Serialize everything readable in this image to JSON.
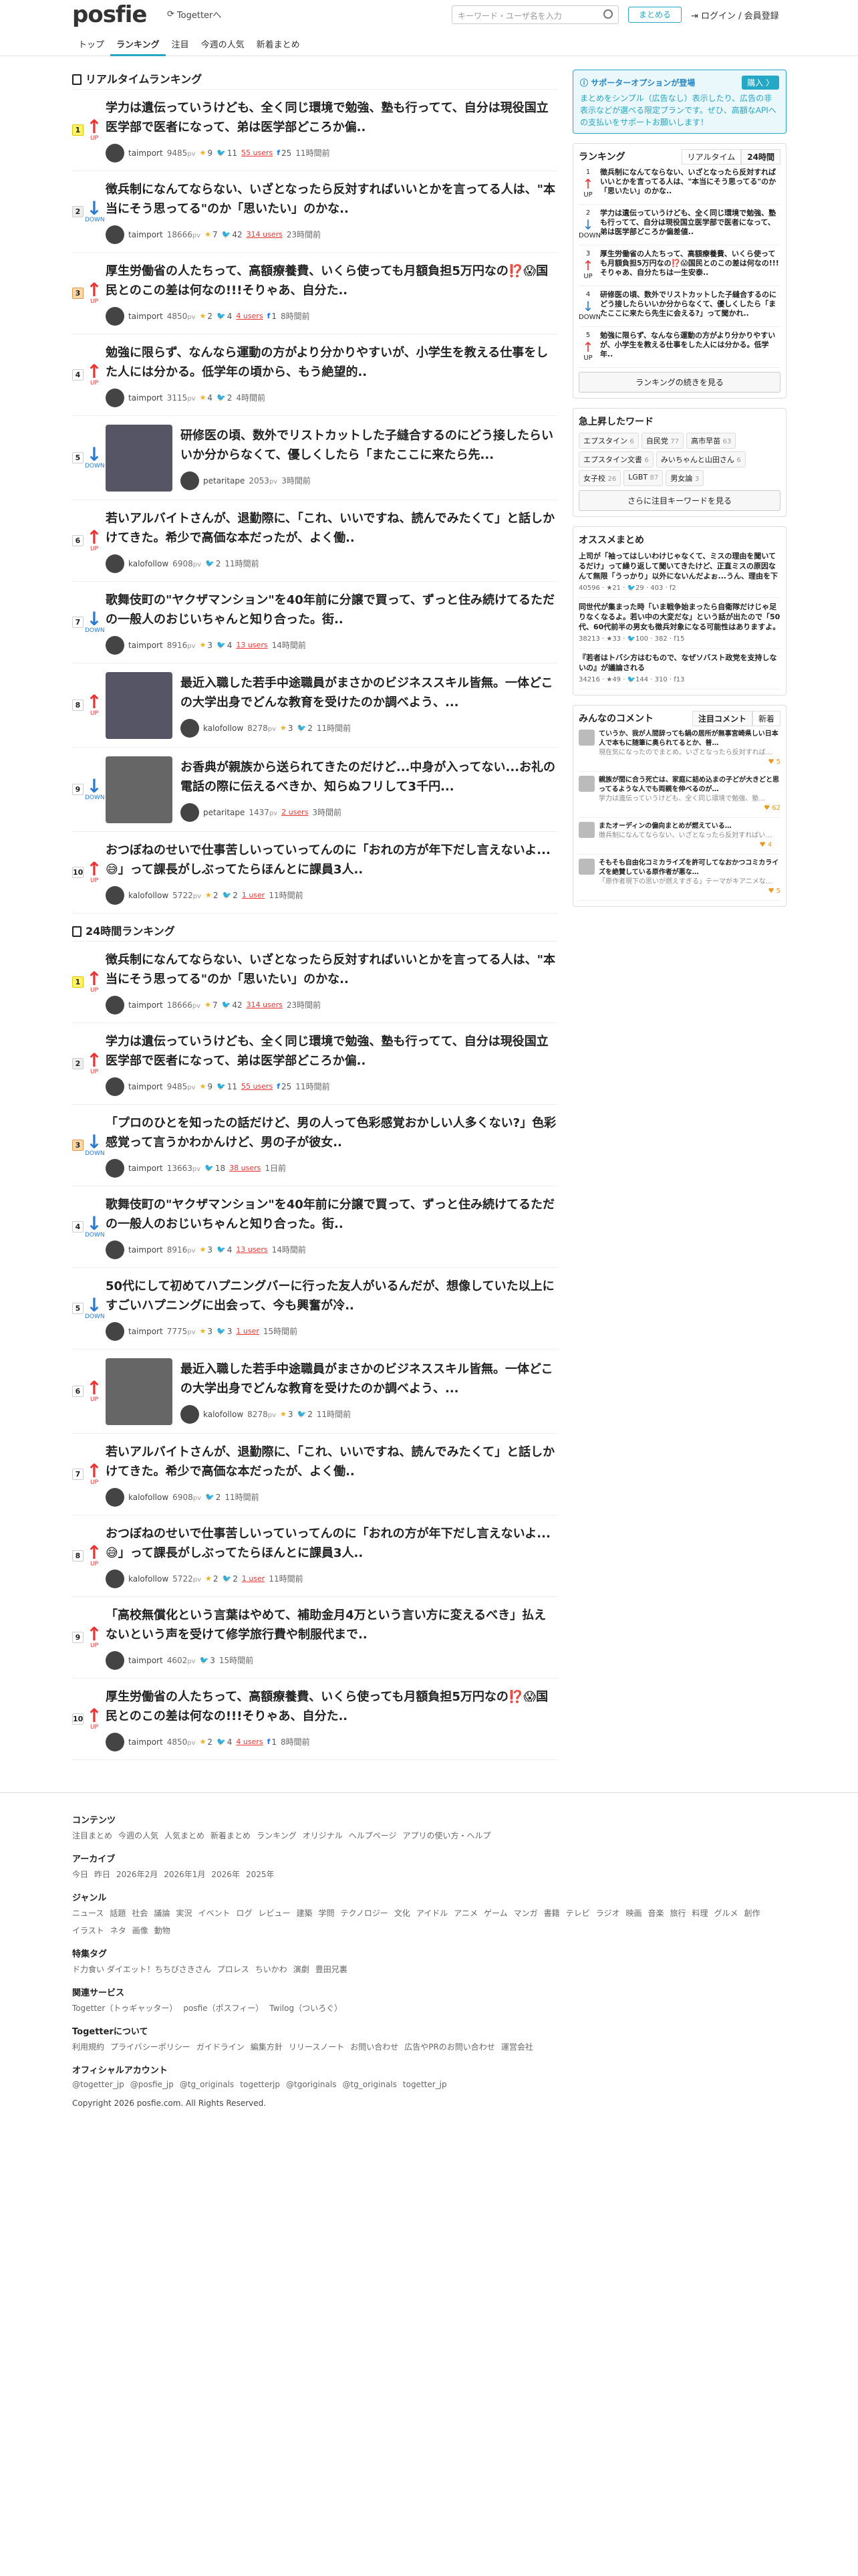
{
  "header": {
    "logo": "posfie",
    "togetter_link": "Togetterへ",
    "search_placeholder": "キーワード・ユーザ名を入力",
    "follow_btn": "まとめる",
    "login": "ログイン / 会員登録"
  },
  "nav": [
    "トップ",
    "ランキング",
    "注目",
    "今週の人気",
    "新着まとめ"
  ],
  "realtime": {
    "title": "リアルタイムランキング",
    "items": [
      {
        "rank": "1",
        "dir": "up",
        "dirlabel": "UP",
        "title": "学力は遺伝っていうけども、全く同じ環境で勉強、塾も行ってて、自分は現役国立医学部で医者になって、弟は医学部どころか偏..",
        "user": "taimport",
        "pv": "9485",
        "star": "9",
        "rt": "11",
        "users": "55 users",
        "fb": "25",
        "time": "11時間前",
        "thumb": false
      },
      {
        "rank": "2",
        "dir": "down",
        "dirlabel": "DOWN",
        "title": "徴兵制になんてならない、いざとなったら反対すればいいとかを言ってる人は、\"本当にそう思ってる\"のか「思いたい」のかな..",
        "user": "taimport",
        "pv": "18666",
        "star": "7",
        "rt": "42",
        "users": "314 users",
        "fb": "",
        "time": "23時間前",
        "thumb": false
      },
      {
        "rank": "3",
        "dir": "up",
        "dirlabel": "UP",
        "title": "厚生労働省の人たちって、高額療養費、いくら使っても月額負担5万円なの⁉️😱国民とのこの差は何なの!!!そりゃあ、自分た..",
        "user": "taimport",
        "pv": "4850",
        "star": "2",
        "rt": "4",
        "users": "4 users",
        "fb": "1",
        "time": "8時間前",
        "thumb": false
      },
      {
        "rank": "4",
        "dir": "up",
        "dirlabel": "UP",
        "title": "勉強に限らず、なんなら運動の方がより分かりやすいが、小学生を教える仕事をした人には分かる。低学年の頃から、もう絶望的..",
        "user": "taimport",
        "pv": "3115",
        "star": "4",
        "rt": "2",
        "users": "",
        "fb": "",
        "time": "4時間前",
        "thumb": false
      },
      {
        "rank": "5",
        "dir": "down",
        "dirlabel": "DOWN",
        "title": "研修医の頃、数外でリストカットした子縫合するのにどう接したらいいか分からなくて、優しくしたら「またここに来たら先...",
        "user": "petaritape",
        "pv": "2053",
        "star": "",
        "rt": "",
        "users": "",
        "fb": "",
        "time": "3時間前",
        "thumb": true
      },
      {
        "rank": "6",
        "dir": "up",
        "dirlabel": "UP",
        "title": "若いアルバイトさんが、退勤際に、「これ、いいですね、読んでみたくて」と話しかけてきた。希少で高価な本だったが、よく働..",
        "user": "kalofollow",
        "pv": "6908",
        "star": "",
        "rt": "2",
        "users": "",
        "fb": "",
        "time": "11時間前",
        "thumb": false
      },
      {
        "rank": "7",
        "dir": "down",
        "dirlabel": "DOWN",
        "title": "歌舞伎町の\"ヤクザマンション\"を40年前に分譲で買って、ずっと住み続けてるただの一般人のおじいちゃんと知り合った。街..",
        "user": "taimport",
        "pv": "8916",
        "star": "3",
        "rt": "4",
        "users": "13 users",
        "fb": "",
        "time": "14時間前",
        "thumb": false
      },
      {
        "rank": "8",
        "dir": "up",
        "dirlabel": "UP",
        "title": "最近入職した若手中途職員がまさかのビジネススキル皆無。一体どこの大学出身でどんな教育を受けたのか調べよう、...",
        "user": "kalofollow",
        "pv": "8278",
        "star": "3",
        "rt": "2",
        "users": "",
        "fb": "",
        "time": "11時間前",
        "thumb": true
      },
      {
        "rank": "9",
        "dir": "down",
        "dirlabel": "DOWN",
        "title": "お香典が親族から送られてきたのだけど...中身が入ってない...お礼の電話の際に伝えるべきか、知らぬフリして3千円...",
        "user": "petaritape",
        "pv": "1437",
        "star": "",
        "rt": "",
        "users": "2 users",
        "fb": "",
        "time": "3時間前",
        "thumb": true
      },
      {
        "rank": "10",
        "dir": "up",
        "dirlabel": "UP",
        "title": "おつぼねのせいで仕事苦しいっていってんのに「おれの方が年下だし言えないよ...😅」って課長がしぶってたらほんとに課員3人..",
        "user": "kalofollow",
        "pv": "5722",
        "star": "2",
        "rt": "2",
        "users": "1 user",
        "fb": "",
        "time": "11時間前",
        "thumb": false
      }
    ]
  },
  "daily": {
    "title": "24時間ランキング",
    "items": [
      {
        "rank": "1",
        "dir": "up",
        "dirlabel": "UP",
        "title": "徴兵制になんてならない、いざとなったら反対すればいいとかを言ってる人は、\"本当にそう思ってる\"のか「思いたい」のかな..",
        "user": "taimport",
        "pv": "18666",
        "star": "7",
        "rt": "42",
        "users": "314 users",
        "fb": "",
        "time": "23時間前",
        "thumb": false
      },
      {
        "rank": "2",
        "dir": "up",
        "dirlabel": "UP",
        "title": "学力は遺伝っていうけども、全く同じ環境で勉強、塾も行ってて、自分は現役国立医学部で医者になって、弟は医学部どころか偏..",
        "user": "taimport",
        "pv": "9485",
        "star": "9",
        "rt": "11",
        "users": "55 users",
        "fb": "25",
        "time": "11時間前",
        "thumb": false
      },
      {
        "rank": "3",
        "dir": "down",
        "dirlabel": "DOWN",
        "title": "「プロのひとを知ったの話だけど、男の人って色彩感覚おかしい人多くない?」色彩感覚って言うかわかんけど、男の子が彼女..",
        "user": "taimport",
        "pv": "13663",
        "star": "",
        "rt": "18",
        "users": "38 users",
        "fb": "",
        "time": "1日前",
        "thumb": false
      },
      {
        "rank": "4",
        "dir": "down",
        "dirlabel": "DOWN",
        "title": "歌舞伎町の\"ヤクザマンション\"を40年前に分譲で買って、ずっと住み続けてるただの一般人のおじいちゃんと知り合った。街..",
        "user": "taimport",
        "pv": "8916",
        "star": "3",
        "rt": "4",
        "users": "13 users",
        "fb": "",
        "time": "14時間前",
        "thumb": false
      },
      {
        "rank": "5",
        "dir": "down",
        "dirlabel": "DOWN",
        "title": "50代にして初めてハプニングバーに行った友人がいるんだが、想像していた以上にすごいハプニングに出会って、今も興奮が冷..",
        "user": "taimport",
        "pv": "7775",
        "star": "3",
        "rt": "3",
        "users": "1 user",
        "fb": "",
        "time": "15時間前",
        "thumb": false
      },
      {
        "rank": "6",
        "dir": "up",
        "dirlabel": "UP",
        "title": "最近入職した若手中途職員がまさかのビジネススキル皆無。一体どこの大学出身でどんな教育を受けたのか調べよう、...",
        "user": "kalofollow",
        "pv": "8278",
        "star": "3",
        "rt": "2",
        "users": "",
        "fb": "",
        "time": "11時間前",
        "thumb": true
      },
      {
        "rank": "7",
        "dir": "up",
        "dirlabel": "UP",
        "title": "若いアルバイトさんが、退勤際に、「これ、いいですね、読んでみたくて」と話しかけてきた。希少で高価な本だったが、よく働..",
        "user": "kalofollow",
        "pv": "6908",
        "star": "",
        "rt": "2",
        "users": "",
        "fb": "",
        "time": "11時間前",
        "thumb": false
      },
      {
        "rank": "8",
        "dir": "up",
        "dirlabel": "UP",
        "title": "おつぼねのせいで仕事苦しいっていってんのに「おれの方が年下だし言えないよ...😅」って課長がしぶってたらほんとに課員3人..",
        "user": "kalofollow",
        "pv": "5722",
        "star": "2",
        "rt": "2",
        "users": "1 user",
        "fb": "",
        "time": "11時間前",
        "thumb": false
      },
      {
        "rank": "9",
        "dir": "up",
        "dirlabel": "UP",
        "title": "「高校無償化という言葉はやめて、補助金月4万という言い方に変えるべき」払えないという声を受けて修学旅行費や制服代まで..",
        "user": "taimport",
        "pv": "4602",
        "star": "",
        "rt": "3",
        "users": "",
        "fb": "",
        "time": "15時間前",
        "thumb": false
      },
      {
        "rank": "10",
        "dir": "up",
        "dirlabel": "UP",
        "title": "厚生労働省の人たちって、高額療養費、いくら使っても月額負担5万円なの⁉️😱国民とのこの差は何なの!!!そりゃあ、自分た..",
        "user": "taimport",
        "pv": "4850",
        "star": "2",
        "rt": "4",
        "users": "4 users",
        "fb": "1",
        "time": "8時間前",
        "thumb": false
      }
    ]
  },
  "side": {
    "support": {
      "title": "サポーターオプションが登場",
      "btn": "購入 〉",
      "text": "まとめをシンプル（広告なし）表示したり、広告の非表示などが選べる限定プランです。ぜひ、高額なAPIへの支払いをサポートお願いします！"
    },
    "ranking": {
      "title": "ランキング",
      "tab1": "リアルタイム",
      "tab2": "24時間",
      "btn": "ランキングの続きを見る",
      "items": [
        {
          "r": "1",
          "a": "↑",
          "l": "UP",
          "t": "徴兵制になんてならない、いざとなったら反対すればいいとかを言ってる人は、\"本当にそう思ってる\"のか「思いたい」のかな.."
        },
        {
          "r": "2",
          "a": "↓",
          "l": "DOWN",
          "t": "学力は遺伝っていうけども、全く同じ環境で勉強、塾も行ってて、自分は現役国立医学部で医者になって、弟は医学部どころか偏差値.."
        },
        {
          "r": "3",
          "a": "↑",
          "l": "UP",
          "t": "厚生労働省の人たちって、高額療養費、いくら使っても月額負担5万円なの⁉️😱国民とのこの差は何なの!!!そりゃあ、自分たちは一生安泰.."
        },
        {
          "r": "4",
          "a": "↓",
          "l": "DOWN",
          "t": "研修医の頃、数外でリストカットした子縫合するのにどう接したらいいか分からなくて、優しくしたら「またここに来たら先生に会える?」って聞かれ.."
        },
        {
          "r": "5",
          "a": "↑",
          "l": "UP",
          "t": "勉強に限らず、なんなら運動の方がより分かりやすいが、小学生を教える仕事をした人には分かる。低学年.."
        }
      ]
    },
    "keywords": {
      "title": "急上昇したワード",
      "btn": "さらに注目キーワードを見る",
      "items": [
        {
          "w": "エプスタイン",
          "n": "6"
        },
        {
          "w": "自民党",
          "n": "77"
        },
        {
          "w": "高市早苗",
          "n": "63"
        },
        {
          "w": "エプスタイン文書",
          "n": "6"
        },
        {
          "w": "みいちゃんと山田さん",
          "n": "6"
        },
        {
          "w": "女子校",
          "n": "26"
        },
        {
          "w": "LGBT",
          "n": "87"
        },
        {
          "w": "男女論",
          "n": "3"
        }
      ]
    },
    "recommend": {
      "title": "オススメまとめ",
      "items": [
        {
          "t": "上司が「袖ってはしいわけじゃなくて、ミスの理由を聞いてるだけ」って繰り返して聞いてきたけど、正直ミスの原因なんて無限「うっかり」以外にないんだよぉ...うん、理由を下げて報告してきた私に対して何個も詰められる、ただひたすら詰められている、やめてくれよ一一一",
          "s": "40596 · ★21 · 🐦29 · 403 · f2"
        },
        {
          "t": "同世代が集まった時「いま戦争始まったら自衛隊だけじゃ足りなくなるよ。若い中の大変だな」という話が出たので「50代、60代前半の男女も徴兵対象になる可能性はありますよ。予備自衛官の年齢上限は52歳未満、違反の人は62歳未満とされる形になりうる」と言ったら、全員「え」って言う顔になる",
          "s": "38213 · ★33 · 🐦100 · 382 · f15"
        },
        {
          "t": "『若者はトバシ方はむもので、なぜソバスト政党を支持しないの』が議論される",
          "s": "34216 · ★49 · 🐦144 · 310 · f13"
        }
      ]
    },
    "comments": {
      "title": "みんなのコメント",
      "tab1": "注目コメント",
      "tab2": "新着",
      "items": [
        {
          "t": "ていうか、我が人間辞っても鍋の居所が無事宮崎県しい日本人で本もに随筆に奥られてるとか、普…",
          "s": "現在気になったのでまとめ。いざとなったら反対すれば…",
          "n": "5"
        },
        {
          "t": "親族が間に合う死亡は、家庭に詰め込まの子どが大きどと思ってるような人でも両親を伸べるのが…",
          "s": "学力は遺伝っていうけども、全く同じ環境で勉強、塾…",
          "n": "62"
        },
        {
          "t": "またオーディンの偏向まとめが燃えている…",
          "s": "徴兵制になんてならない、いざとなったら反対すればい…",
          "n": "4"
        },
        {
          "t": "そもそも自由化コミカライズを許可してなおかつコミカライズを絶賛している原作者が悪な…",
          "s": "「原作者現下の思いが燃えすぎる」テーマがキアニメな…",
          "n": "5"
        }
      ]
    }
  },
  "footer": {
    "contents_h": "コンテンツ",
    "contents": [
      "注目まとめ",
      "今週の人気",
      "人気まとめ",
      "新着まとめ",
      "ランキング",
      "オリジナル",
      "ヘルプページ",
      "アプリの使い方・ヘルプ"
    ],
    "archive_h": "アーカイブ",
    "archive": [
      "今日",
      "昨日",
      "2026年2月",
      "2026年1月",
      "2026年",
      "2025年"
    ],
    "genre_h": "ジャンル",
    "genre": [
      "ニュース",
      "話題",
      "社会",
      "議論",
      "実況",
      "イベント",
      "ログ",
      "レビュー",
      "建築",
      "学問",
      "テクノロジー",
      "文化",
      "アイドル",
      "アニメ",
      "ゲーム",
      "マンガ",
      "書籍",
      "テレビ",
      "ラジオ",
      "映画",
      "音楽",
      "旅行",
      "料理",
      "グルメ",
      "創作",
      "イラスト",
      "ネタ",
      "画像",
      "動物"
    ],
    "tag_h": "特集タグ",
    "tags": [
      "ド力食い ダイエット！ちちびさきさん",
      "プロレス",
      "ちいかわ",
      "演劇",
      "豊田兄裏"
    ],
    "svc_h": "関連サービス",
    "svcs": [
      "Togetter（トゥギャッター）",
      "posfie（ポスフィー）",
      "Twilog（ついろぐ）"
    ],
    "about_h": "Togetterについて",
    "about": [
      "利用規約",
      "プライバシーポリシー",
      "ガイドライン",
      "編集方針",
      "リリースノート",
      "お問い合わせ",
      "広告やPRのお問い合わせ",
      "運営会社"
    ],
    "acc_h": "オフィシャルアカウント",
    "accs": [
      "@togetter_jp",
      "@posfie_jp",
      "@tg_originals",
      "togetterjp",
      "@tgoriginals",
      "@tg_originals",
      "togetter_jp"
    ],
    "copyright": "Copyright 2026 posfie.com. All Rights Reserved."
  }
}
